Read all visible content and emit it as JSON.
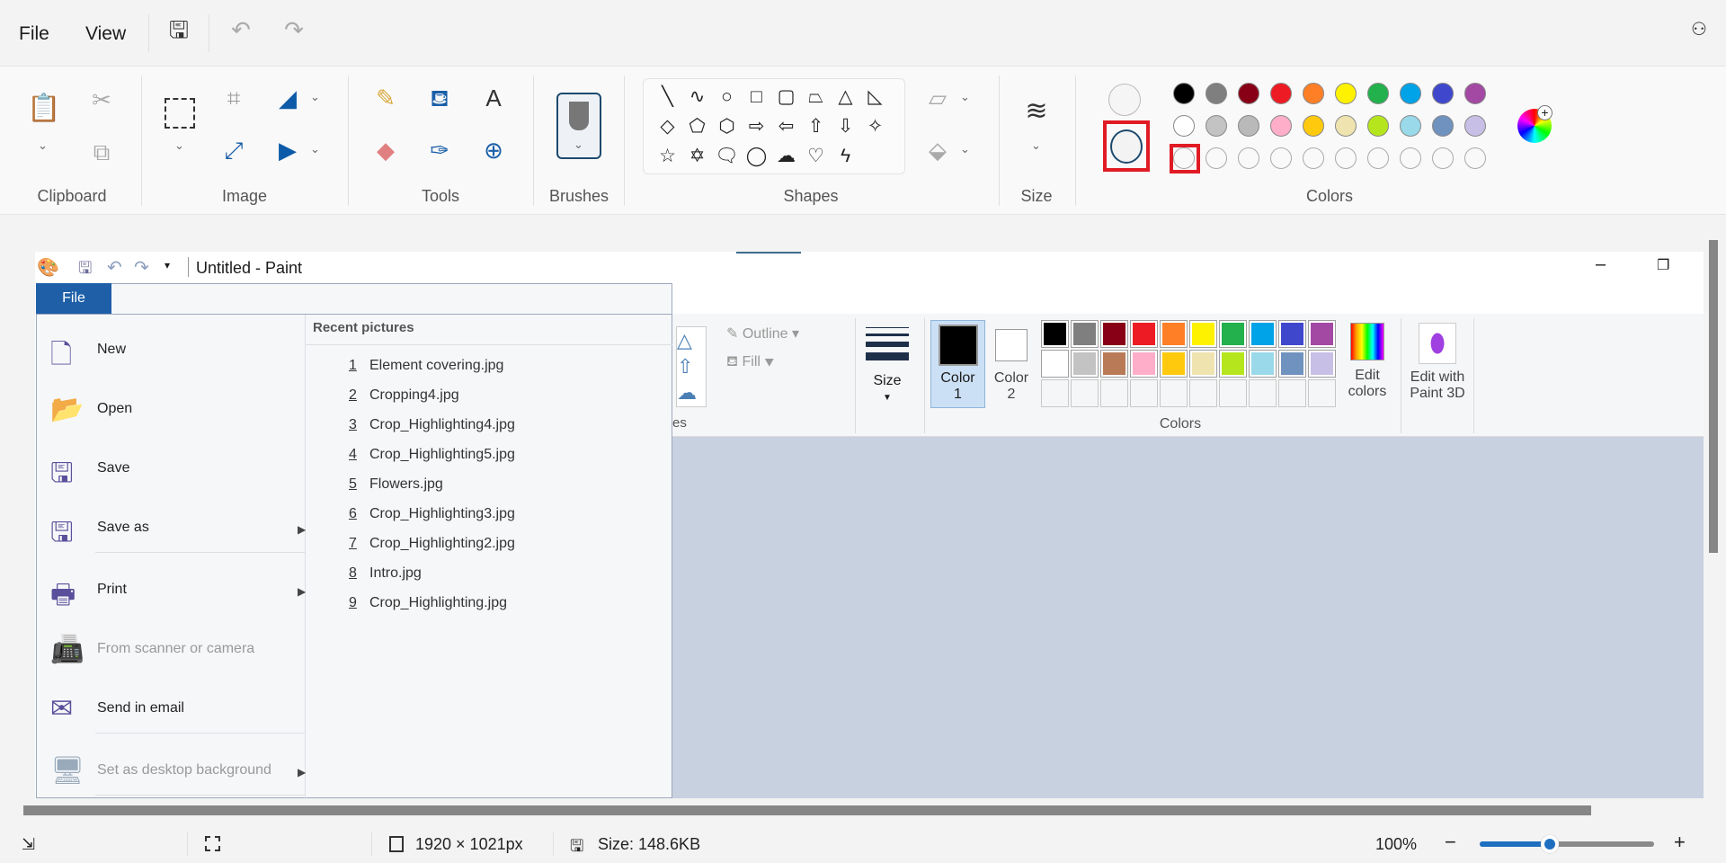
{
  "menubar": {
    "file": "File",
    "view": "View",
    "icons": [
      "save-icon",
      "undo-icon",
      "redo-icon",
      "share-icon"
    ]
  },
  "ribbon": {
    "groups": {
      "clipboard": "Clipboard",
      "image": "Image",
      "tools": "Tools",
      "brushes": "Brushes",
      "shapes": "Shapes",
      "size": "Size",
      "colors": "Colors"
    },
    "shapes": [
      "╲",
      "∿",
      "○",
      "□",
      "▢",
      "⏢",
      "△",
      "◺",
      "◇",
      "⬠",
      "⬡",
      "⇨",
      "⇦",
      "⇧",
      "⇩",
      "✧",
      "☆",
      "✡",
      "🗨",
      "◯",
      "☁",
      "♡",
      "ϟ"
    ],
    "palette_row1": [
      "#000000",
      "#7f7f7f",
      "#880015",
      "#ed1c24",
      "#ff7f27",
      "#fff200",
      "#22b14c",
      "#00a2e8",
      "#3f48cc",
      "#a349a4"
    ],
    "palette_row2": [
      "#ffffff",
      "#c3c3c3",
      "#b9b9b9",
      "#ffaec9",
      "#ffc90e",
      "#efe4b0",
      "#b5e61d",
      "#99d9ea",
      "#7092be",
      "#c8bfe7"
    ],
    "highlight_color": "#e01b24"
  },
  "embedded": {
    "title": "Untitled - Paint",
    "file_tab": "File",
    "menu": [
      {
        "label": "New",
        "icon": "new-file-icon"
      },
      {
        "label": "Open",
        "icon": "open-folder-icon"
      },
      {
        "label": "Save",
        "icon": "save-icon"
      },
      {
        "label": "Save as",
        "icon": "save-as-icon"
      },
      {
        "label": "Print",
        "icon": "printer-icon"
      },
      {
        "label": "From scanner or camera",
        "icon": "scanner-icon"
      },
      {
        "label": "Send in email",
        "icon": "email-icon"
      },
      {
        "label": "Set as desktop background",
        "icon": "desktop-icon"
      }
    ],
    "recent_header": "Recent pictures",
    "recent": [
      {
        "n": "1",
        "name": "Element covering.jpg"
      },
      {
        "n": "2",
        "name": "Cropping4.jpg"
      },
      {
        "n": "3",
        "name": "Crop_Highlighting4.jpg"
      },
      {
        "n": "4",
        "name": "Crop_Highlighting5.jpg"
      },
      {
        "n": "5",
        "name": "Flowers.jpg"
      },
      {
        "n": "6",
        "name": "Crop_Highlighting3.jpg"
      },
      {
        "n": "7",
        "name": "Crop_Highlighting2.jpg"
      },
      {
        "n": "8",
        "name": "Intro.jpg"
      },
      {
        "n": "9",
        "name": "Crop_Highlighting.jpg"
      }
    ],
    "ribbon": {
      "outline": "Outline",
      "fill": "Fill",
      "size": "Size",
      "color1": "Color",
      "color1_n": "1",
      "color2": "Color",
      "color2_n": "2",
      "edit_colors_1": "Edit",
      "edit_colors_2": "colors",
      "paint3d_1": "Edit with",
      "paint3d_2": "Paint 3D",
      "colors_label": "Colors",
      "shapes_label_fragment": "es",
      "palette_row1": [
        "#000000",
        "#7f7f7f",
        "#880015",
        "#ed1c24",
        "#ff7f27",
        "#fff200",
        "#22b14c",
        "#00a2e8",
        "#3f48cc",
        "#a349a4"
      ],
      "palette_row2": [
        "#ffffff",
        "#c3c3c3",
        "#b97a57",
        "#ffaec9",
        "#ffc90e",
        "#efe4b0",
        "#b5e61d",
        "#99d9ea",
        "#7092be",
        "#c8bfe7"
      ]
    }
  },
  "status": {
    "dimensions": "1920 × 1021px",
    "size": "Size: 148.6KB",
    "zoom": "100%",
    "zoom_slider_fraction": 0.4
  }
}
